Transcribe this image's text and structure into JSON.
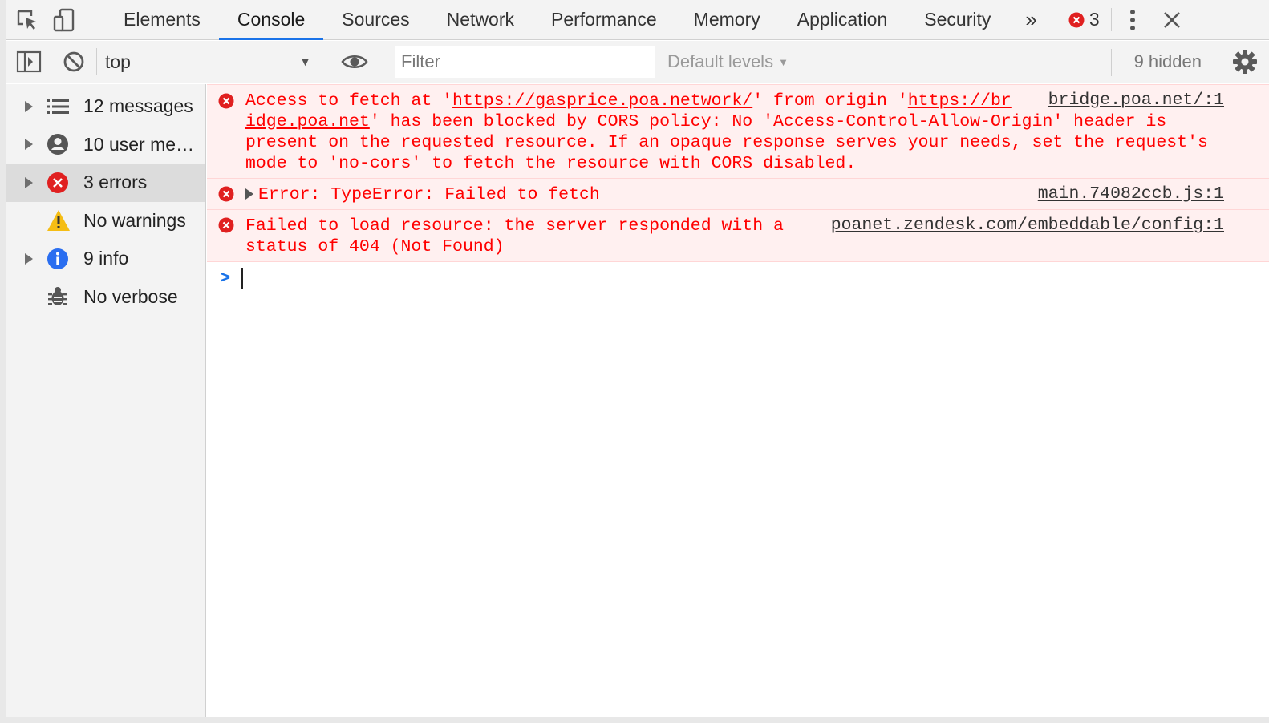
{
  "tabs": [
    {
      "label": "Elements"
    },
    {
      "label": "Console"
    },
    {
      "label": "Sources"
    },
    {
      "label": "Network"
    },
    {
      "label": "Performance"
    },
    {
      "label": "Memory"
    },
    {
      "label": "Application"
    },
    {
      "label": "Security"
    }
  ],
  "active_tab": "Console",
  "more_tabs_glyph": "»",
  "error_badge_count": "3",
  "toolbar": {
    "context": "top",
    "filter_placeholder": "Filter",
    "levels_label": "Default levels",
    "hidden_label": "9 hidden"
  },
  "sidebar": {
    "items": [
      {
        "label": "12 messages",
        "icon": "list-icon",
        "expandable": true
      },
      {
        "label": "10 user me…",
        "icon": "user-icon",
        "expandable": true
      },
      {
        "label": "3 errors",
        "icon": "error-icon",
        "expandable": true,
        "selected": true
      },
      {
        "label": "No warnings",
        "icon": "warning-icon",
        "expandable": false
      },
      {
        "label": "9 info",
        "icon": "info-icon",
        "expandable": true
      },
      {
        "label": "No verbose",
        "icon": "bug-icon",
        "expandable": false
      }
    ]
  },
  "messages": {
    "m1": {
      "pre1": "Access to fetch at '",
      "url1": "https://gasprice.poa.network/",
      "mid": "' from origin '",
      "url2a": "https://br",
      "url2b": "idge.poa.net",
      "post": "' has been blocked by CORS policy: No 'Access-Control-Allow-Origin' header is present on the requested resource. If an opaque response serves your needs, set the request's mode to 'no-cors' to fetch the resource with CORS disabled.",
      "source": "bridge.poa.net/:1"
    },
    "m2": {
      "text": "Error:  TypeError: Failed to fetch",
      "source": "main.74082ccb.js:1"
    },
    "m3": {
      "line1": "Failed to load resource: the server responded with a",
      "line2": "status of 404 (Not Found)",
      "source": "poanet.zendesk.com/embeddable/config:1"
    }
  },
  "prompt_glyph": ">",
  "colors": {
    "error": "#ff0000",
    "error_bg": "#fff0f0",
    "accent": "#1a73e8",
    "toolbar_bg": "#f3f3f3"
  }
}
